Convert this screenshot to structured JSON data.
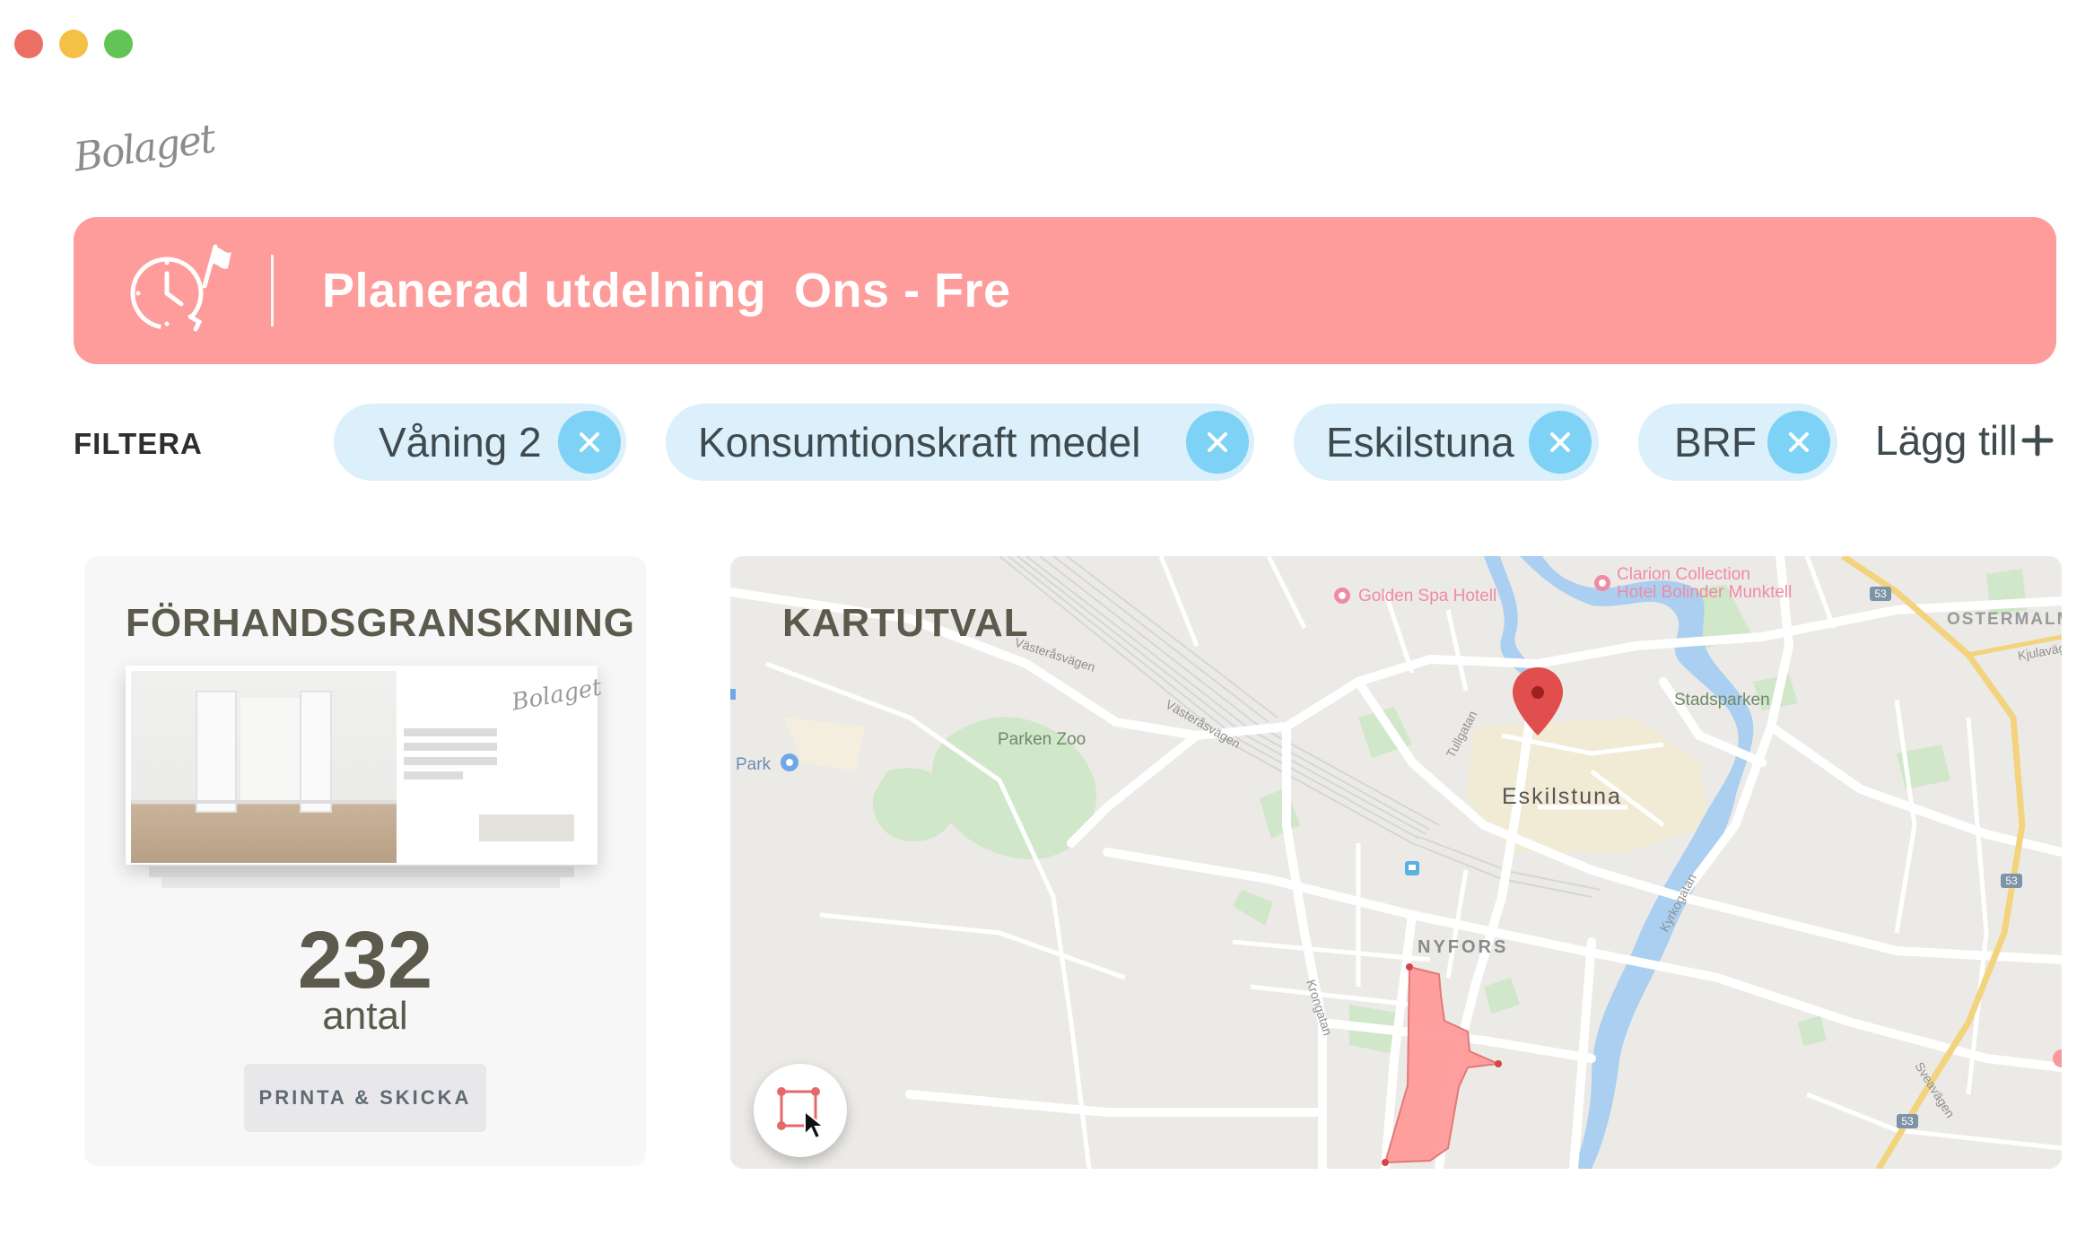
{
  "app": {
    "logo_text": "Bolaget"
  },
  "banner": {
    "title": "Planerad utdelning  Ons - Fre",
    "icon": "clock-flag-icon",
    "background_color": "#fe9b9b"
  },
  "filters": {
    "label": "FILTERA",
    "chips": [
      {
        "label": "Våning 2"
      },
      {
        "label": "Konsumtionskraft medel"
      },
      {
        "label": "Eskilstuna"
      },
      {
        "label": "BRF"
      }
    ],
    "add_label": "Lägg till"
  },
  "preview": {
    "title": "FÖRHANDSGRANSKNING",
    "count": "232",
    "count_unit": "antal",
    "print_button": "PRINTA & SKICKA",
    "sheet_logo": "Bolaget"
  },
  "map": {
    "title": "KARTUTVAL",
    "labels": {
      "golden_spa": "Golden Spa Hotell",
      "clarion_1": "Clarion Collection",
      "clarion_2": "Hotel Bolinder Munktell",
      "ostermalm": "OSTERMALM",
      "kjulavagen": "Kjulavägen",
      "vasterasvagen_1": "Västeråsvägen",
      "vasterasvagen_2": "Västeråsvägen",
      "parken_zoo": "Parken Zoo",
      "park": "Park",
      "tullgatan": "Tullgatan",
      "stadsparken": "Stadsparken",
      "eskilstuna": "Eskilstuna",
      "kyrkogatan": "Kyrkogatan",
      "nyfors": "NYFORS",
      "krongatan": "Krongatan",
      "sveavagen": "Sveavägen",
      "road_53": "53"
    },
    "draw_tool_icon": "draw-area-icon",
    "pin_icon": "map-pin-icon"
  }
}
